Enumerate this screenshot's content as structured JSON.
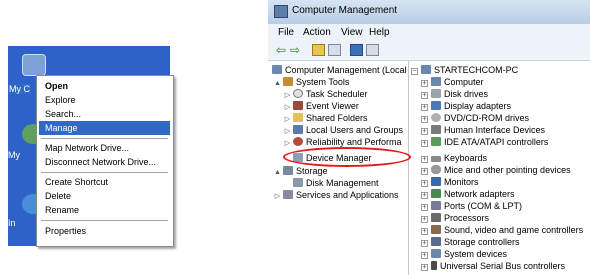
{
  "desktop": {
    "icons": [
      {
        "label": "My C"
      },
      {
        "label": "My"
      },
      {
        "label": "In"
      }
    ]
  },
  "context_menu": {
    "items": [
      "Open",
      "Explore",
      "Search...",
      "Manage",
      "Map Network Drive...",
      "Disconnect Network Drive...",
      "Create Shortcut",
      "Delete",
      "Rename",
      "Properties"
    ],
    "default_item": "Open",
    "selected_item": "Manage"
  },
  "window": {
    "title": "Computer Management",
    "menu": [
      "File",
      "Action",
      "View",
      "Help"
    ]
  },
  "left_tree": [
    {
      "label": "Computer Management (Local",
      "level": 0,
      "icon": "computer-management-icon"
    },
    {
      "label": "System Tools",
      "level": 1,
      "icon": "tools-icon",
      "expander": "▲"
    },
    {
      "label": "Task Scheduler",
      "level": 2,
      "icon": "clock-icon",
      "expander": "▷"
    },
    {
      "label": "Event Viewer",
      "level": 2,
      "icon": "event-viewer-icon",
      "expander": "▷"
    },
    {
      "label": "Shared Folders",
      "level": 2,
      "icon": "folder-icon",
      "expander": "▷"
    },
    {
      "label": "Local Users and Groups",
      "level": 2,
      "icon": "users-icon",
      "expander": "▷"
    },
    {
      "label": "Reliability and Performa",
      "level": 2,
      "icon": "performance-icon",
      "expander": "▷"
    },
    {
      "label": "Device Manager",
      "level": 2,
      "icon": "device-manager-icon",
      "expander": ""
    },
    {
      "label": "Storage",
      "level": 1,
      "icon": "storage-icon",
      "expander": "▲"
    },
    {
      "label": "Disk Management",
      "level": 2,
      "icon": "disk-icon",
      "expander": ""
    },
    {
      "label": "Services and Applications",
      "level": 1,
      "icon": "services-icon",
      "expander": "▷"
    }
  ],
  "right_tree": {
    "root": "STARTECHCOM-PC",
    "items": [
      "Computer",
      "Disk drives",
      "Display adapters",
      "DVD/CD-ROM drives",
      "Human Interface Devices",
      "IDE ATA/ATAPI controllers",
      "Keyboards",
      "Mice and other pointing devices",
      "Monitors",
      "Network adapters",
      "Ports (COM & LPT)",
      "Processors",
      "Sound, video and game controllers",
      "Storage controllers",
      "System devices",
      "Universal Serial Bus controllers"
    ]
  },
  "colors": {
    "desktop_bg": "#2f62c8",
    "menu_highlight": "#316ac5",
    "annotation_ellipse": "#e21b1b"
  }
}
